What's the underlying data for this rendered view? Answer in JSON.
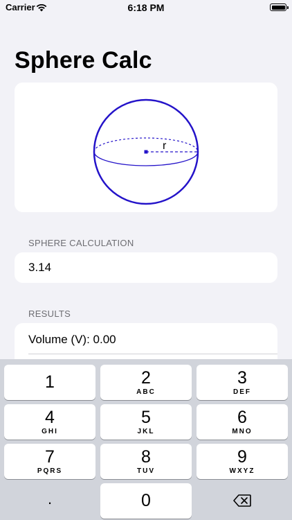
{
  "status_bar": {
    "carrier": "Carrier",
    "time": "6:18 PM"
  },
  "app": {
    "title": "Sphere Calc"
  },
  "diagram": {
    "radius_label": "r"
  },
  "input_section": {
    "header": "SPHERE CALCULATION",
    "value": "3.14"
  },
  "results_section": {
    "header": "RESULTS",
    "rows": [
      "Volume (V): 0.00"
    ]
  },
  "keypad": {
    "keys": [
      {
        "digit": "1",
        "letters": ""
      },
      {
        "digit": "2",
        "letters": "ABC"
      },
      {
        "digit": "3",
        "letters": "DEF"
      },
      {
        "digit": "4",
        "letters": "GHI"
      },
      {
        "digit": "5",
        "letters": "JKL"
      },
      {
        "digit": "6",
        "letters": "MNO"
      },
      {
        "digit": "7",
        "letters": "PQRS"
      },
      {
        "digit": "8",
        "letters": "TUV"
      },
      {
        "digit": "9",
        "letters": "WXYZ"
      },
      {
        "digit": ".",
        "letters": ""
      },
      {
        "digit": "0",
        "letters": ""
      }
    ],
    "delete_icon": "backspace-icon"
  },
  "colors": {
    "accent": "#2413c9",
    "background": "#f2f2f7",
    "keyboard": "#d1d4db"
  }
}
